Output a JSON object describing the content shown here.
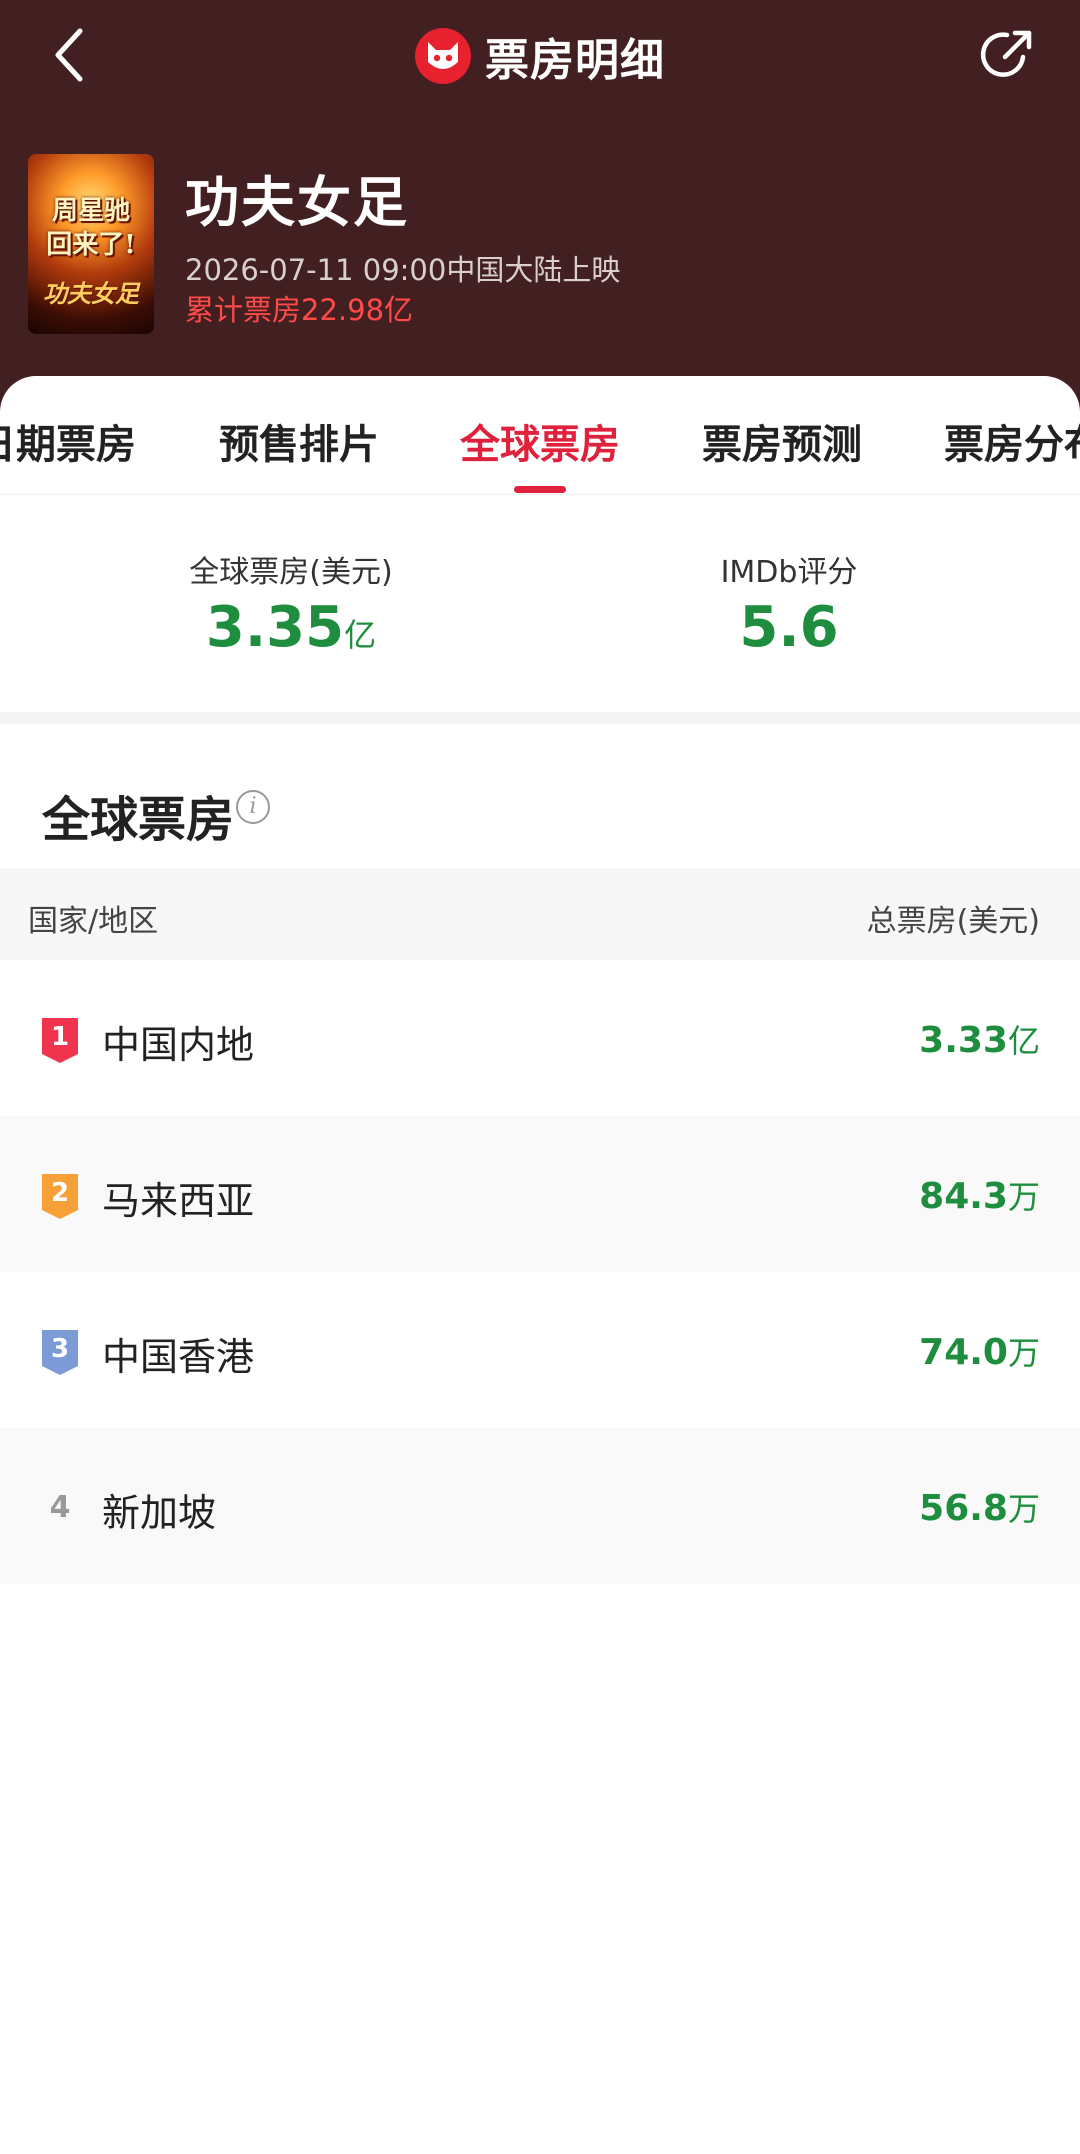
{
  "header": {
    "page_title": "票房明细",
    "icons": {
      "back": "chevron-left-icon",
      "logo": "cat-logo-icon",
      "share": "share-icon"
    },
    "colors": {
      "background": "#421f20",
      "accent": "#e0213b"
    }
  },
  "movie": {
    "title": "功夫女足",
    "release_info": "2026-07-11 09:00中国大陆上映",
    "total_box_office": "累计票房22.98亿",
    "poster_text": "周星驰\n回来了!",
    "poster_sub": "功夫女足"
  },
  "tabs": [
    {
      "label": "日期票房",
      "active": false
    },
    {
      "label": "预售排片",
      "active": false
    },
    {
      "label": "全球票房",
      "active": true
    },
    {
      "label": "票房预测",
      "active": false
    },
    {
      "label": "票房分布",
      "active": false
    }
  ],
  "summary": {
    "global": {
      "label": "全球票房(美元)",
      "value": "3.35",
      "unit": "亿"
    },
    "imdb": {
      "label": "IMDb评分",
      "value": "5.6"
    }
  },
  "section": {
    "title": "全球票房",
    "info_icon": "info-icon",
    "col_region": "国家/地区",
    "col_total": "总票房(美元)"
  },
  "rows": [
    {
      "rank": "1",
      "region": "中国内地",
      "value": "3.33",
      "unit": "亿",
      "badge_color": "#f0344d"
    },
    {
      "rank": "2",
      "region": "马来西亚",
      "value": "84.3",
      "unit": "万",
      "badge_color": "#f7a038"
    },
    {
      "rank": "3",
      "region": "中国香港",
      "value": "74.0",
      "unit": "万",
      "badge_color": "#7b9ad6"
    },
    {
      "rank": "4",
      "region": "新加坡",
      "value": "56.8",
      "unit": "万",
      "badge_color": ""
    }
  ],
  "value_color": "#1e8e3e"
}
